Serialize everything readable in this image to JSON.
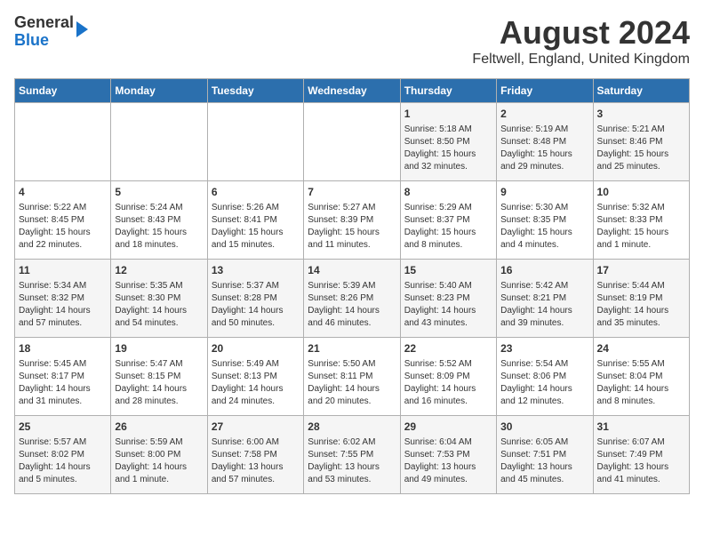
{
  "header": {
    "logo_line1": "General",
    "logo_line2": "Blue",
    "title": "August 2024",
    "subtitle": "Feltwell, England, United Kingdom"
  },
  "days_of_week": [
    "Sunday",
    "Monday",
    "Tuesday",
    "Wednesday",
    "Thursday",
    "Friday",
    "Saturday"
  ],
  "weeks": [
    [
      {
        "day": "",
        "content": ""
      },
      {
        "day": "",
        "content": ""
      },
      {
        "day": "",
        "content": ""
      },
      {
        "day": "",
        "content": ""
      },
      {
        "day": "1",
        "content": "Sunrise: 5:18 AM\nSunset: 8:50 PM\nDaylight: 15 hours\nand 32 minutes."
      },
      {
        "day": "2",
        "content": "Sunrise: 5:19 AM\nSunset: 8:48 PM\nDaylight: 15 hours\nand 29 minutes."
      },
      {
        "day": "3",
        "content": "Sunrise: 5:21 AM\nSunset: 8:46 PM\nDaylight: 15 hours\nand 25 minutes."
      }
    ],
    [
      {
        "day": "4",
        "content": "Sunrise: 5:22 AM\nSunset: 8:45 PM\nDaylight: 15 hours\nand 22 minutes."
      },
      {
        "day": "5",
        "content": "Sunrise: 5:24 AM\nSunset: 8:43 PM\nDaylight: 15 hours\nand 18 minutes."
      },
      {
        "day": "6",
        "content": "Sunrise: 5:26 AM\nSunset: 8:41 PM\nDaylight: 15 hours\nand 15 minutes."
      },
      {
        "day": "7",
        "content": "Sunrise: 5:27 AM\nSunset: 8:39 PM\nDaylight: 15 hours\nand 11 minutes."
      },
      {
        "day": "8",
        "content": "Sunrise: 5:29 AM\nSunset: 8:37 PM\nDaylight: 15 hours\nand 8 minutes."
      },
      {
        "day": "9",
        "content": "Sunrise: 5:30 AM\nSunset: 8:35 PM\nDaylight: 15 hours\nand 4 minutes."
      },
      {
        "day": "10",
        "content": "Sunrise: 5:32 AM\nSunset: 8:33 PM\nDaylight: 15 hours\nand 1 minute."
      }
    ],
    [
      {
        "day": "11",
        "content": "Sunrise: 5:34 AM\nSunset: 8:32 PM\nDaylight: 14 hours\nand 57 minutes."
      },
      {
        "day": "12",
        "content": "Sunrise: 5:35 AM\nSunset: 8:30 PM\nDaylight: 14 hours\nand 54 minutes."
      },
      {
        "day": "13",
        "content": "Sunrise: 5:37 AM\nSunset: 8:28 PM\nDaylight: 14 hours\nand 50 minutes."
      },
      {
        "day": "14",
        "content": "Sunrise: 5:39 AM\nSunset: 8:26 PM\nDaylight: 14 hours\nand 46 minutes."
      },
      {
        "day": "15",
        "content": "Sunrise: 5:40 AM\nSunset: 8:23 PM\nDaylight: 14 hours\nand 43 minutes."
      },
      {
        "day": "16",
        "content": "Sunrise: 5:42 AM\nSunset: 8:21 PM\nDaylight: 14 hours\nand 39 minutes."
      },
      {
        "day": "17",
        "content": "Sunrise: 5:44 AM\nSunset: 8:19 PM\nDaylight: 14 hours\nand 35 minutes."
      }
    ],
    [
      {
        "day": "18",
        "content": "Sunrise: 5:45 AM\nSunset: 8:17 PM\nDaylight: 14 hours\nand 31 minutes."
      },
      {
        "day": "19",
        "content": "Sunrise: 5:47 AM\nSunset: 8:15 PM\nDaylight: 14 hours\nand 28 minutes."
      },
      {
        "day": "20",
        "content": "Sunrise: 5:49 AM\nSunset: 8:13 PM\nDaylight: 14 hours\nand 24 minutes."
      },
      {
        "day": "21",
        "content": "Sunrise: 5:50 AM\nSunset: 8:11 PM\nDaylight: 14 hours\nand 20 minutes."
      },
      {
        "day": "22",
        "content": "Sunrise: 5:52 AM\nSunset: 8:09 PM\nDaylight: 14 hours\nand 16 minutes."
      },
      {
        "day": "23",
        "content": "Sunrise: 5:54 AM\nSunset: 8:06 PM\nDaylight: 14 hours\nand 12 minutes."
      },
      {
        "day": "24",
        "content": "Sunrise: 5:55 AM\nSunset: 8:04 PM\nDaylight: 14 hours\nand 8 minutes."
      }
    ],
    [
      {
        "day": "25",
        "content": "Sunrise: 5:57 AM\nSunset: 8:02 PM\nDaylight: 14 hours\nand 5 minutes."
      },
      {
        "day": "26",
        "content": "Sunrise: 5:59 AM\nSunset: 8:00 PM\nDaylight: 14 hours\nand 1 minute."
      },
      {
        "day": "27",
        "content": "Sunrise: 6:00 AM\nSunset: 7:58 PM\nDaylight: 13 hours\nand 57 minutes."
      },
      {
        "day": "28",
        "content": "Sunrise: 6:02 AM\nSunset: 7:55 PM\nDaylight: 13 hours\nand 53 minutes."
      },
      {
        "day": "29",
        "content": "Sunrise: 6:04 AM\nSunset: 7:53 PM\nDaylight: 13 hours\nand 49 minutes."
      },
      {
        "day": "30",
        "content": "Sunrise: 6:05 AM\nSunset: 7:51 PM\nDaylight: 13 hours\nand 45 minutes."
      },
      {
        "day": "31",
        "content": "Sunrise: 6:07 AM\nSunset: 7:49 PM\nDaylight: 13 hours\nand 41 minutes."
      }
    ]
  ]
}
